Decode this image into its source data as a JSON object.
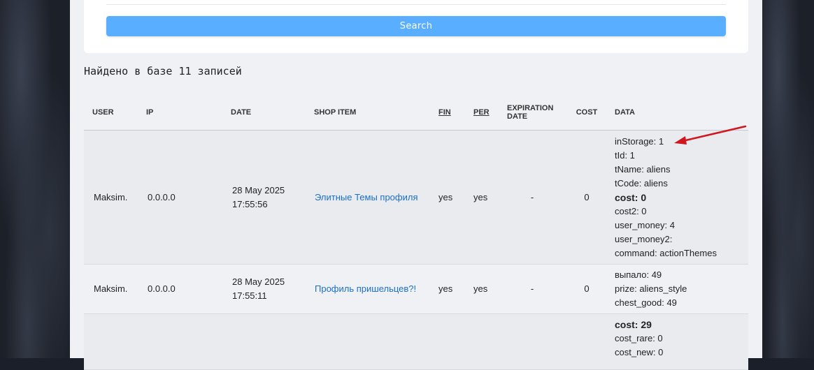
{
  "search": {
    "button_label": "Search"
  },
  "results": {
    "found_text": "Найдено в базе 11 записей"
  },
  "table": {
    "headers": {
      "user": "USER",
      "ip": "IP",
      "date": "DATE",
      "shop_item": "SHOP ITEM",
      "fin": "FIN",
      "per": "PER",
      "expiration_1": "EXPIRATION",
      "expiration_2": "DATE",
      "cost": "COST",
      "data": "DATA"
    },
    "rows": [
      {
        "user": "Maksim.",
        "ip": "0.0.0.0",
        "date": "28 May 2025",
        "time": "17:55:56",
        "item": "Элитные Темы профиля",
        "fin": "yes",
        "per": "yes",
        "expiration": "-",
        "cost": "0",
        "data": [
          "inStorage: 1",
          "tId: 1",
          "tName: aliens",
          "tCode: aliens",
          "cost: 0",
          "cost2: 0",
          "user_money: 4",
          "user_money2:",
          "command: actionThemes"
        ]
      },
      {
        "user": "Maksim.",
        "ip": "0.0.0.0",
        "date": "28 May 2025",
        "time": "17:55:11",
        "item": "Профиль пришельцев?!",
        "fin": "yes",
        "per": "yes",
        "expiration": "-",
        "cost": "0",
        "data": [
          "выпало: 49",
          "prize: aliens_style",
          "chest_good: 49"
        ]
      },
      {
        "data": [
          "cost: 29",
          "cost_rare: 0",
          "cost_new: 0"
        ]
      }
    ]
  },
  "colors": {
    "accent": "#5aaeff",
    "link": "#1a6fc7",
    "annotation_arrow": "#d0161e"
  }
}
